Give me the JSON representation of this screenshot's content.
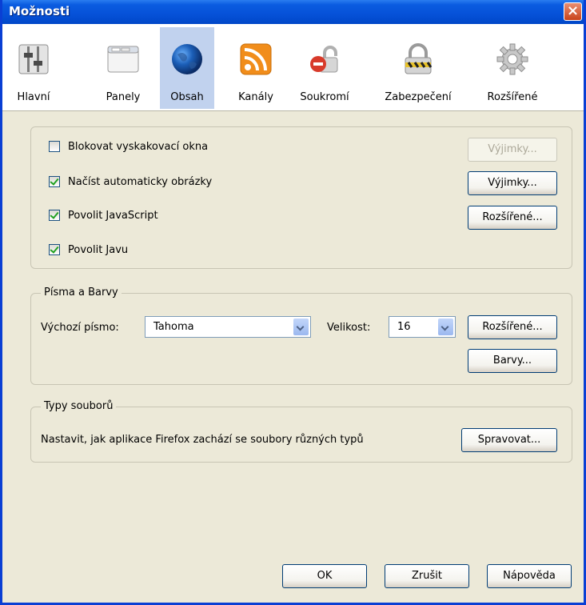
{
  "window": {
    "title": "Možnosti",
    "close_label": "×"
  },
  "toolbar": {
    "panes": [
      {
        "label": "Hlavní",
        "icon": "main-switch-icon"
      },
      {
        "label": "Panely",
        "icon": "tabs-window-icon"
      },
      {
        "label": "Obsah",
        "icon": "globe-icon",
        "selected": true
      },
      {
        "label": "Kanály",
        "icon": "rss-feed-icon"
      },
      {
        "label": "Soukromí",
        "icon": "privacy-mask-icon"
      },
      {
        "label": "Zabezpečení",
        "icon": "padlock-icon"
      },
      {
        "label": "Rozšířené",
        "icon": "gear-icon"
      }
    ]
  },
  "content": {
    "checkboxes": [
      {
        "label": "Blokovat vyskakovací okna",
        "checked": false,
        "button": "Výjimky...",
        "button_enabled": false
      },
      {
        "label": "Načíst automaticky obrázky",
        "checked": true,
        "button": "Výjimky...",
        "button_enabled": true
      },
      {
        "label": "Povolit JavaScript",
        "checked": true,
        "button": "Rozšířené...",
        "button_enabled": true
      },
      {
        "label": "Povolit Javu",
        "checked": true
      }
    ]
  },
  "fonts": {
    "legend": "Písma a Barvy",
    "default_font_label": "Výchozí písmo:",
    "default_font_value": "Tahoma",
    "size_label": "Velikost:",
    "size_value": "16",
    "advanced_button": "Rozšířené...",
    "colors_button": "Barvy..."
  },
  "filetypes": {
    "legend": "Typy souborů",
    "description": "Nastavit, jak aplikace Firefox zachází se soubory různých typů",
    "manage_button": "Spravovat..."
  },
  "footer": {
    "ok": "OK",
    "cancel": "Zrušit",
    "help": "Nápověda"
  },
  "colors": {
    "title_bar": "#0651d8",
    "dialog_bg": "#ece9d8",
    "selected_pane": "#c1d2ee",
    "close_button": "#c9431a"
  }
}
